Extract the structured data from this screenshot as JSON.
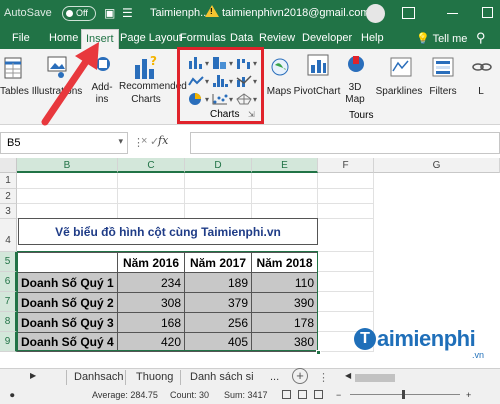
{
  "titlebar": {
    "autosave_label": "AutoSave",
    "autosave_state": "Off",
    "document": "Taimienph...",
    "email": "taimienphivn2018@gmail.com"
  },
  "tabs": [
    {
      "label": "File"
    },
    {
      "label": "Home"
    },
    {
      "label": "Insert"
    },
    {
      "label": "Page Layout"
    },
    {
      "label": "Formulas"
    },
    {
      "label": "Data"
    },
    {
      "label": "Review"
    },
    {
      "label": "Developer"
    },
    {
      "label": "Help"
    }
  ],
  "active_tab": "Insert",
  "tell_me": "Tell me",
  "ribbon": {
    "tables": "Tables",
    "illustrations": "Illustrations",
    "addins": "Add-ins",
    "recommended_charts_1": "Recommended",
    "recommended_charts_2": "Charts",
    "maps": "Maps",
    "pivotchart": "PivotChart",
    "map3d_1": "3D",
    "map3d_2": "Map",
    "sparklines": "Sparklines",
    "filters": "Filters",
    "links": "L",
    "charts_group": "Charts",
    "tours_group": "Tours"
  },
  "formula_bar": {
    "name_box": "B5",
    "fx": "fx",
    "value": ""
  },
  "columns": [
    "B",
    "C",
    "D",
    "E",
    "F",
    "G"
  ],
  "rows": [
    "1",
    "2",
    "3",
    "4",
    "5",
    "6",
    "7",
    "8",
    "9"
  ],
  "sheet": {
    "title": "Vẽ biểu đồ hình cột cùng Taimienphi.vn",
    "headers": [
      "Năm 2016",
      "Năm 2017",
      "Năm 2018"
    ],
    "data_rows": [
      {
        "label": "Doanh Số Quý 1",
        "values": [
          "234",
          "189",
          "110"
        ]
      },
      {
        "label": "Doanh Số Quý 2",
        "values": [
          "308",
          "379",
          "390"
        ]
      },
      {
        "label": "Doanh Số Quý 3",
        "values": [
          "168",
          "256",
          "178"
        ]
      },
      {
        "label": "Doanh Số Quý 4",
        "values": [
          "420",
          "405",
          "380"
        ]
      }
    ]
  },
  "sheet_tabs": [
    "Danhsach",
    "Thuong",
    "Danh sách si"
  ],
  "sheet_tab_more": "...",
  "status": {
    "average": "Average: 284.75",
    "count": "Count: 30",
    "sum": "Sum: 3417"
  },
  "watermark": {
    "brand": "aimienphi",
    "t": "T",
    "tld": ".vn"
  },
  "accent_colors": {
    "excel_green": "#217346",
    "highlight_red": "#e0232b",
    "arrow_red": "#e8383d"
  }
}
